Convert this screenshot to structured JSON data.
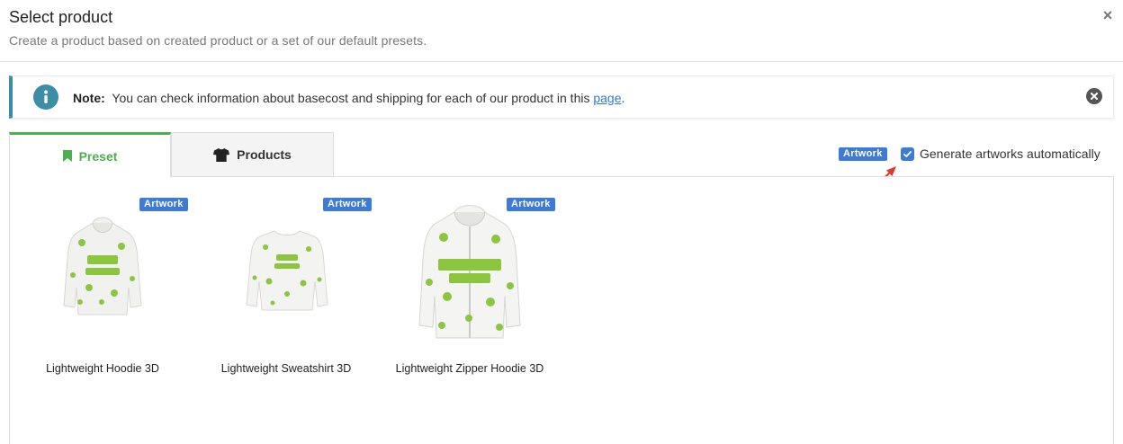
{
  "header": {
    "title": "Select product",
    "subtitle": "Create a product based on created product or a set of our default presets."
  },
  "note": {
    "label": "Note:",
    "text": "You can check information about basecost and shipping for each of our product in this",
    "link": "page",
    "suffix": "."
  },
  "tabs": [
    {
      "label": "Preset",
      "icon": "bookmark-icon",
      "active": true
    },
    {
      "label": "Products",
      "icon": "tshirt-icon",
      "active": false
    }
  ],
  "auto": {
    "badge": "Artwork",
    "label": "Generate artworks automatically",
    "checked": true
  },
  "products": [
    {
      "name": "Lightweight Hoodie 3D",
      "badge": "Artwork"
    },
    {
      "name": "Lightweight Sweatshirt 3D",
      "badge": "Artwork"
    },
    {
      "name": "Lightweight Zipper Hoodie 3D",
      "badge": "Artwork"
    }
  ],
  "colors": {
    "accent_green": "#4caf50",
    "badge_blue": "#3e7bd6",
    "note_border": "#3b8ea8",
    "link": "#2f7ad1",
    "arrow_red": "#e0392b"
  }
}
